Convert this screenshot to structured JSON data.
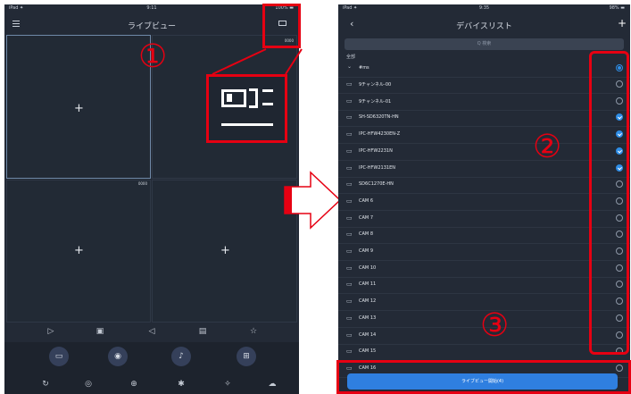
{
  "left_screen": {
    "status": {
      "carrier": "iPad ✦",
      "time": "9:11",
      "battery": "100% ▬"
    },
    "title": "ライブビュー",
    "menu_icon": "hamburger-icon",
    "channels_icon": "channel-layout-icon",
    "grid": {
      "cell_tag": "0000",
      "add_icon": "plus-icon"
    },
    "toolbar_icons": [
      "play-icon",
      "gallery-icon",
      "speaker-icon",
      "screen-icon",
      "star-icon"
    ],
    "control_buttons": [
      "record-icon",
      "camera-icon",
      "mic-icon",
      "grid-icon"
    ],
    "bottom_icons": [
      "ptz-icon",
      "focus-icon",
      "zoom-icon",
      "brightness-icon",
      "settings-icon",
      "cloud-icon"
    ]
  },
  "right_screen": {
    "status": {
      "carrier": "iPad ✦",
      "time": "9:35",
      "battery": "98% ▬"
    },
    "title": "デバイスリスト",
    "back_icon": "back-chevron-icon",
    "add_icon": "plus-icon",
    "search_placeholder": "Q 検索",
    "section_label": "全部",
    "group_row": "#ms",
    "devices": [
      {
        "name": "9チャンネル-00",
        "checked": false
      },
      {
        "name": "9チャンネル-01",
        "checked": false
      },
      {
        "name": "SH-SD6320TN-HN",
        "checked": true
      },
      {
        "name": "IPC-HFW4230EN-Z",
        "checked": true
      },
      {
        "name": "IPC-HFW2231N",
        "checked": true
      },
      {
        "name": "IPC-HFW2131EN",
        "checked": true
      },
      {
        "name": "SD6C1270E-HN",
        "checked": false
      },
      {
        "name": "CAM 6",
        "checked": false
      },
      {
        "name": "CAM 7",
        "checked": false
      },
      {
        "name": "CAM 8",
        "checked": false
      },
      {
        "name": "CAM 9",
        "checked": false
      },
      {
        "name": "CAM 10",
        "checked": false
      },
      {
        "name": "CAM 11",
        "checked": false
      },
      {
        "name": "CAM 12",
        "checked": false
      },
      {
        "name": "CAM 13",
        "checked": false
      },
      {
        "name": "CAM 14",
        "checked": false
      },
      {
        "name": "CAM 15",
        "checked": false
      },
      {
        "name": "CAM 16",
        "checked": false
      }
    ],
    "start_button": "ライブビュー開始(4)"
  },
  "annotations": {
    "step1": "①",
    "step2": "②",
    "step3": "③"
  },
  "colors": {
    "annotation_red": "#e60012",
    "accent_blue": "#2e8de6",
    "screen_bg": "#232a36"
  }
}
